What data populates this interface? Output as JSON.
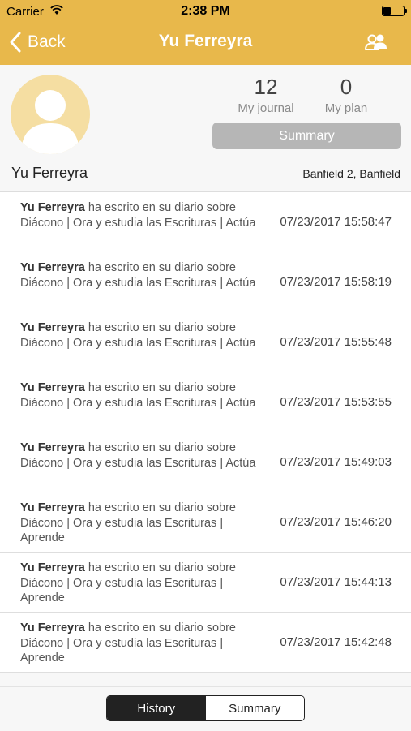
{
  "status_bar": {
    "carrier": "Carrier",
    "time": "2:38 PM"
  },
  "nav": {
    "back_label": "Back",
    "title": "Yu Ferreyra"
  },
  "profile": {
    "journal_count": "12",
    "journal_label": "My journal",
    "plan_count": "0",
    "plan_label": "My plan",
    "summary_button": "Summary",
    "name": "Yu Ferreyra",
    "location": "Banfield 2, Banfield"
  },
  "entries": [
    {
      "author": "Yu Ferreyra",
      "text": " ha escrito en su diario sobre Diácono | Ora y estudia las Escrituras | Actúa",
      "timestamp": "07/23/2017 15:58:47"
    },
    {
      "author": "Yu Ferreyra",
      "text": " ha escrito en su diario sobre Diácono | Ora y estudia las Escrituras | Actúa",
      "timestamp": "07/23/2017 15:58:19"
    },
    {
      "author": "Yu Ferreyra",
      "text": " ha escrito en su diario sobre Diácono | Ora y estudia las Escrituras | Actúa",
      "timestamp": "07/23/2017 15:55:48"
    },
    {
      "author": "Yu Ferreyra",
      "text": " ha escrito en su diario sobre Diácono | Ora y estudia las Escrituras | Actúa",
      "timestamp": "07/23/2017 15:53:55"
    },
    {
      "author": "Yu Ferreyra",
      "text": " ha escrito en su diario sobre Diácono | Ora y estudia las Escrituras | Actúa",
      "timestamp": "07/23/2017 15:49:03"
    },
    {
      "author": "Yu Ferreyra",
      "text": " ha escrito en su diario sobre Diácono | Ora y estudia las Escrituras | Aprende",
      "timestamp": "07/23/2017 15:46:20"
    },
    {
      "author": "Yu Ferreyra",
      "text": " ha escrito en su diario sobre Diácono | Ora y estudia las Escrituras | Aprende",
      "timestamp": "07/23/2017 15:44:13"
    },
    {
      "author": "Yu Ferreyra",
      "text": " ha escrito en su diario sobre Diácono | Ora y estudia las Escrituras | Aprende",
      "timestamp": "07/23/2017 15:42:48"
    }
  ],
  "bottom_tabs": {
    "history": "History",
    "summary": "Summary",
    "selected": "History"
  },
  "colors": {
    "header": "#e8b84b",
    "avatar_bg": "#f5dea2",
    "summary_button": "#b6b6b6",
    "segment_active": "#222222"
  },
  "icons": {
    "back": "chevron-left-icon",
    "group": "people-icon",
    "wifi": "wifi-icon",
    "battery": "battery-icon",
    "avatar": "person-silhouette-icon"
  }
}
